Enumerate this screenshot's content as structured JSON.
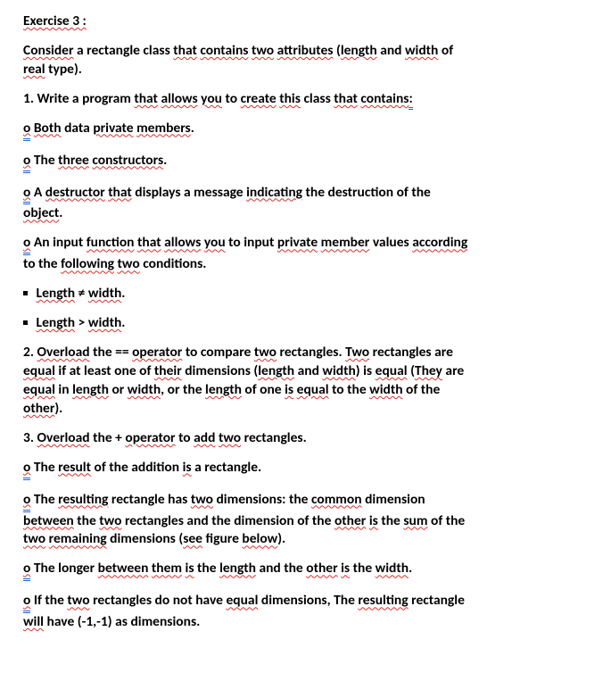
{
  "title": "Exercise 3 :",
  "intro": {
    "t1a": "Consider",
    "t1b": "a rectangle class",
    "t1c": "that",
    "t1d": "contains",
    "t1e": "two",
    "t1f": "attributes",
    "t1g": "(",
    "t1h": "length",
    "t1i": "and",
    "t1j": "width",
    "t1k": "of",
    "t2a": "real",
    "t2b": "type)."
  },
  "q1": {
    "h_a": "1. Write a program",
    "h_b": "that",
    "h_c": "allows",
    "h_d": "you",
    "h_e": "to",
    "h_f": "create",
    "h_g": "this",
    "h_h": "class",
    "h_i": "that",
    "h_j": "contains",
    "h_k": ":",
    "l1_o": "o",
    "l1_a": "Both",
    "l1_b": "data",
    "l1_c": "private",
    "l1_d": "members",
    "l1_e": ".",
    "l2_o": "o",
    "l2_a": "The",
    "l2_b": "three",
    "l2_c": "constructors",
    "l2_d": ".",
    "l3_o": "o",
    "l3_a": "A",
    "l3_b": "destructor",
    "l3_c": "that",
    "l3_d": "displays a message",
    "l3_e": "indicating",
    "l3_f": "the destruction of the",
    "l3_g": "object",
    "l3_h": ".",
    "l4_o": "o",
    "l4_a": "An input",
    "l4_b": "function",
    "l4_c": "that",
    "l4_d": "allows",
    "l4_e": "you",
    "l4_f": "to input",
    "l4_g": "private",
    "l4_h": "member",
    "l4_i": "values",
    "l4_j": "according",
    "l4_k": "to the",
    "l4_l": "following",
    "l4_m": "two",
    "l4_n": "conditions.",
    "c1_a": "Length",
    "c1_b": "≠",
    "c1_c": "width",
    "c1_d": ".",
    "c2_a": "Length",
    "c2_b": ">",
    "c2_c": "width",
    "c2_d": "."
  },
  "q2": {
    "h_a": "2.",
    "h_b": "Overload",
    "h_c": "the ==",
    "h_d": "operator",
    "h_e": "to compare",
    "h_f": "two",
    "h_g": "rectangles.",
    "h_h": "Two",
    "h_i": "rectangles are",
    "r2_a": "equal",
    "r2_b": "if at least one of",
    "r2_c": "their",
    "r2_d": "dimensions (",
    "r2_e": "length",
    "r2_f": "and",
    "r2_g": "width",
    "r2_h": ") is",
    "r2_i": "equal",
    "r2_j": "(",
    "r2_k": "They",
    "r2_l": "are",
    "r3_a": "equal",
    "r3_b": "in",
    "r3_c": "length",
    "r3_d": "or",
    "r3_e": "width",
    "r3_f": ", or the",
    "r3_g": "length",
    "r3_h": "of one",
    "r3_i": "is",
    "r3_j": "equal",
    "r3_k": "to the",
    "r3_l": "width",
    "r3_m": "of the",
    "r4_a": "other",
    "r4_b": ")."
  },
  "q3": {
    "h_a": "3.",
    "h_b": "Overload",
    "h_c": "the +",
    "h_d": "operator",
    "h_e": "to",
    "h_f": "add",
    "h_g": "two",
    "h_h": "rectangles.",
    "l1_o": "o",
    "l1_a": "The",
    "l1_b": "result",
    "l1_c": "of the addition",
    "l1_d": "is",
    "l1_e": "a rectangle.",
    "l2_o": "o",
    "l2_a": "The",
    "l2_b": "resulting",
    "l2_c": "rectangle has",
    "l2_d": "two",
    "l2_e": "dimensions: the",
    "l2_f": "common",
    "l2_g": "dimension",
    "l2r2_a": "between",
    "l2r2_b": "the",
    "l2r2_c": "two",
    "l2r2_d": "rectangles and the dimension of the",
    "l2r2_e": "other",
    "l2r2_f": "is",
    "l2r2_g": "the",
    "l2r2_h": "sum",
    "l2r2_i": "of the",
    "l2r3_a": "two",
    "l2r3_b": "remaining",
    "l2r3_c": "dimensions (",
    "l2r3_d": "see",
    "l2r3_e": "figure",
    "l2r3_f": "below",
    "l2r3_g": ").",
    "l3_o": "o",
    "l3_a": "The longer",
    "l3_b": "between",
    "l3_c": "them",
    "l3_d": "is",
    "l3_e": "the",
    "l3_f": "length",
    "l3_g": "and the",
    "l3_h": "other",
    "l3_i": "is",
    "l3_j": "the",
    "l3_k": "width",
    "l3_l": ".",
    "l4_o": "o",
    "l4_a": "If the",
    "l4_b": "two",
    "l4_c": "rectangles do not have",
    "l4_d": "equal",
    "l4_e": "dimensions, The",
    "l4_f": "resulting",
    "l4_g": "rectangle",
    "l4r2_a": "will",
    "l4r2_b": "have (-1,-1) as dimensions."
  }
}
